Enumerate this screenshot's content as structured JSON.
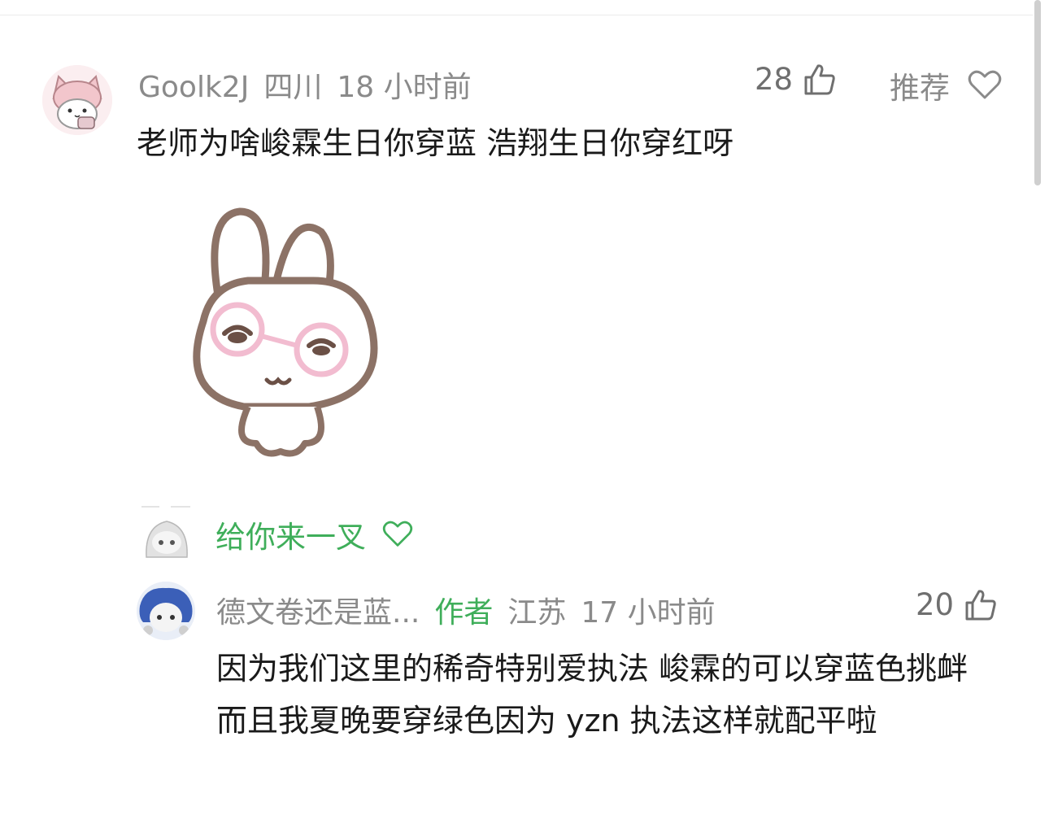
{
  "comment": {
    "username": "Goolk2J",
    "location": "四川",
    "time": "18 小时前",
    "likes": "28",
    "recommend_label": "推荐",
    "text": "老师为啥峻霖生日你穿蓝 浩翔生日你穿红呀"
  },
  "reply_sticker": {
    "text": "给你来一叉"
  },
  "reply": {
    "username": "德文卷还是蓝...",
    "author_tag": "作者",
    "location": "江苏",
    "time": "17 小时前",
    "likes": "20",
    "text": "因为我们这里的稀奇特别爱执法 峻霖的可以穿蓝色挑衅 而且我夏晚要穿绿色因为 yzn 执法这样就配平啦"
  },
  "colors": {
    "accent_green": "#3fae5a",
    "meta_gray": "#8a8a8a",
    "text": "#1a1a1a"
  },
  "icons": {
    "like": "thumbs-up-icon",
    "recommend": "heart-outline-icon"
  }
}
